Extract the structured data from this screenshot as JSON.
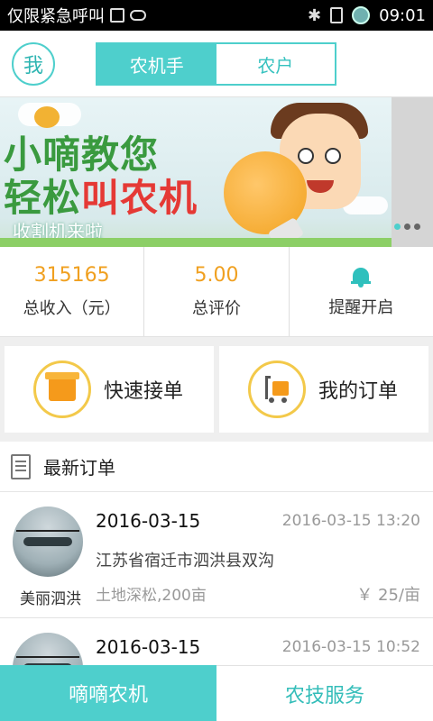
{
  "status_bar": {
    "carrier": "仅限紧急呼叫",
    "time": "09:01"
  },
  "header": {
    "avatar_label": "我",
    "segments": [
      "农机手",
      "农户"
    ],
    "active_segment": 0
  },
  "banner": {
    "title_line1": "小嘀教您",
    "title_line2_plain": "轻松",
    "title_line2_highlight": "叫农机",
    "subtitle": "收割机来啦",
    "page_count": 3,
    "active_page": 0
  },
  "stats": {
    "income_value": "315165",
    "income_label": "总收入（元）",
    "rating_value": "5.00",
    "rating_label": "总评价",
    "reminder_label": "提醒开启"
  },
  "quick_actions": {
    "accept_label": "快速接单",
    "orders_label": "我的订单"
  },
  "section": {
    "title": "最新订单"
  },
  "orders": [
    {
      "name": "美丽泗洪",
      "date": "2016-03-15",
      "time": "2016-03-15 13:20",
      "address": "江苏省宿迁市泗洪县双沟",
      "task": "土地深松,200亩",
      "price": "￥ 25/亩"
    },
    {
      "name": "",
      "date": "2016-03-15",
      "time": "2016-03-15 10:52",
      "address": "",
      "task": "",
      "price": ""
    }
  ],
  "tabbar": {
    "tab1": "嘀嘀农机",
    "tab2": "农技服务"
  },
  "colors": {
    "accent": "#4ecfcc",
    "stat_value": "#f0a020",
    "banner_green": "#3a9a3f",
    "banner_red": "#e53935"
  }
}
